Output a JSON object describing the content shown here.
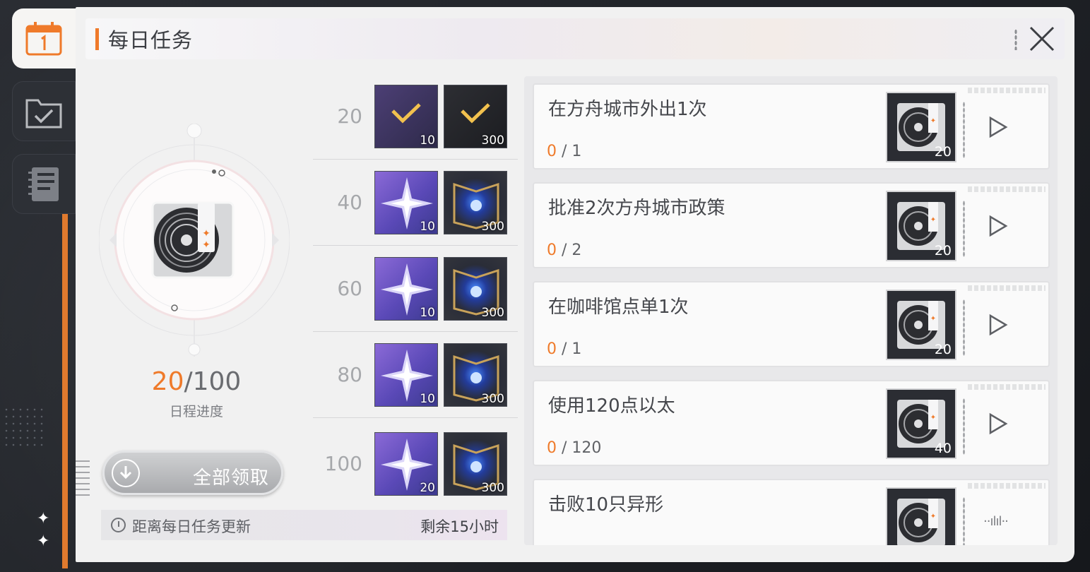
{
  "header": {
    "title": "每日任务"
  },
  "progress": {
    "current": "20",
    "total": "/100",
    "label": "日程进度",
    "value": 20,
    "max": 100
  },
  "claim_all": {
    "label": "全部领取"
  },
  "refresh": {
    "label": "距离每日任务更新",
    "remaining": "剩余15小时"
  },
  "milestones": [
    {
      "score": "20",
      "rewards": [
        {
          "qty": "10",
          "icon": "star-crystal-icon",
          "claimed": true
        },
        {
          "qty": "300",
          "icon": "book-icon",
          "claimed": true
        }
      ]
    },
    {
      "score": "40",
      "rewards": [
        {
          "qty": "10",
          "icon": "star-crystal-icon",
          "claimed": false
        },
        {
          "qty": "300",
          "icon": "book-icon",
          "claimed": false
        }
      ]
    },
    {
      "score": "60",
      "rewards": [
        {
          "qty": "10",
          "icon": "star-crystal-icon",
          "claimed": false
        },
        {
          "qty": "300",
          "icon": "book-icon",
          "claimed": false
        }
      ]
    },
    {
      "score": "80",
      "rewards": [
        {
          "qty": "10",
          "icon": "star-crystal-icon",
          "claimed": false
        },
        {
          "qty": "300",
          "icon": "book-icon",
          "claimed": false
        }
      ]
    },
    {
      "score": "100",
      "rewards": [
        {
          "qty": "20",
          "icon": "star-crystal-icon",
          "claimed": false
        },
        {
          "qty": "300",
          "icon": "book-icon",
          "claimed": false
        }
      ]
    }
  ],
  "tasks": [
    {
      "title": "在方舟城市外出1次",
      "done": "0",
      "goal": " / 1",
      "reward_qty": "20",
      "action": "play-icon"
    },
    {
      "title": "批准2次方舟城市政策",
      "done": "0",
      "goal": " / 2",
      "reward_qty": "20",
      "action": "play-icon"
    },
    {
      "title": "在咖啡馆点单1次",
      "done": "0",
      "goal": " / 1",
      "reward_qty": "20",
      "action": "play-icon"
    },
    {
      "title": "使用120点以太",
      "done": "0",
      "goal": " / 120",
      "reward_qty": "40",
      "action": "play-icon"
    },
    {
      "title": "击败10只异形",
      "done": "",
      "goal": "",
      "reward_qty": "",
      "action": "waveform-icon",
      "action_text": "··ılıl··"
    }
  ],
  "colors": {
    "accent": "#ef7a2a",
    "panel": "#f1f1f1",
    "star_reward": "#6f58c8"
  }
}
